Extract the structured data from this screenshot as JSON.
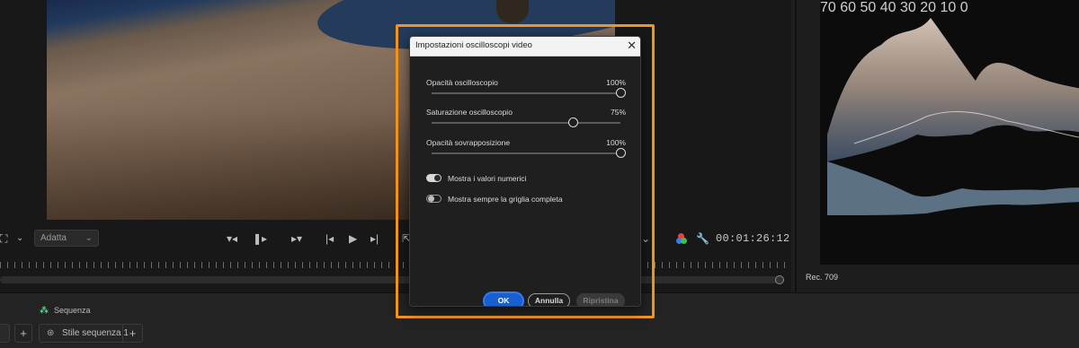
{
  "dialog": {
    "title": "Impostazioni oscilloscopi video",
    "close_glyph": "✕",
    "sliders": [
      {
        "label": "Opacità oscilloscopio",
        "value": "100%",
        "level": 1.0
      },
      {
        "label": "Saturazione oscilloscopio",
        "value": "75%",
        "level": 0.75
      },
      {
        "label": "Opacità sovrapposizione",
        "value": "100%",
        "level": 1.0
      }
    ],
    "toggles": [
      {
        "label": "Mostra i valori numerici",
        "on": true
      },
      {
        "label": "Mostra sempre la griglia completa",
        "on": false
      }
    ],
    "buttons": {
      "ok": "OK",
      "cancel": "Annulla",
      "reset": "Ripristina"
    }
  },
  "program_monitor": {
    "fit_select": "Adatta",
    "timecode": "00:01:26:12"
  },
  "scope": {
    "ticks": [
      "70",
      "60",
      "50",
      "40",
      "30",
      "20",
      "10",
      "0"
    ],
    "colorspace": "Rec. 709"
  },
  "sequence": {
    "header": "Sequenza",
    "style_tab": "Stile sequenza 1",
    "add_glyph": "+"
  },
  "colors": {
    "highlight": "#f2951e",
    "primary_button": "#1a5fd0"
  }
}
